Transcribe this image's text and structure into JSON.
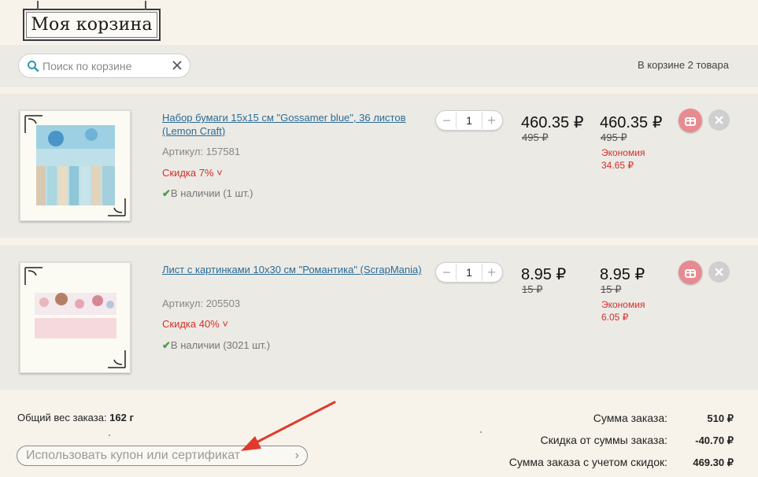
{
  "header": {
    "title": "Моя корзина"
  },
  "search": {
    "placeholder": "Поиск по корзине"
  },
  "cart": {
    "count_text": "В корзине 2 товара"
  },
  "items": [
    {
      "name": "Набор бумаги 15х15 см \"Gossamer blue\", 36 листов (Lemon Craft)",
      "sku": "Артикул: 157581",
      "discount": "Скидка 7% ˅",
      "stock": "В наличии (1 шт.)",
      "quantity": "1",
      "unit_price": "460.35 ₽",
      "unit_old_price": "495 ₽",
      "total_price": "460.35 ₽",
      "total_old_price": "495 ₽",
      "economy_label": "Экономия",
      "economy_value": "34.65 ₽"
    },
    {
      "name": "Лист с картинками 10х30 см \"Романтика\" (ScrapMania)",
      "sku": "Артикул: 205503",
      "discount": "Скидка 40% ˅",
      "stock": "В наличии (3021 шт.)",
      "quantity": "1",
      "unit_price": "8.95 ₽",
      "unit_old_price": "15 ₽",
      "total_price": "8.95 ₽",
      "total_old_price": "15 ₽",
      "economy_label": "Экономия",
      "economy_value": "6.05 ₽"
    }
  ],
  "summary": {
    "weight_label": "Общий вес заказа:",
    "weight_value": "162 г",
    "coupon_placeholder": "Использовать купон или сертификат",
    "order_sum_label": "Сумма заказа:",
    "order_sum_value": "510 ₽",
    "discount_label": "Скидка от суммы заказа:",
    "discount_value": "-40.70 ₽",
    "total_label": "Сумма заказа с учетом скидок:",
    "total_value": "469.30 ₽"
  },
  "colors": {
    "accent_red": "#d2302a",
    "link_blue": "#2b6c95",
    "fav_pink": "#e88a91",
    "annotation_arrow": "#e03a2c"
  },
  "icons": {
    "search": "search-icon",
    "clear": "close-icon",
    "favorite": "gift-icon",
    "remove": "close-icon",
    "chevron": "chevron-right-icon"
  }
}
